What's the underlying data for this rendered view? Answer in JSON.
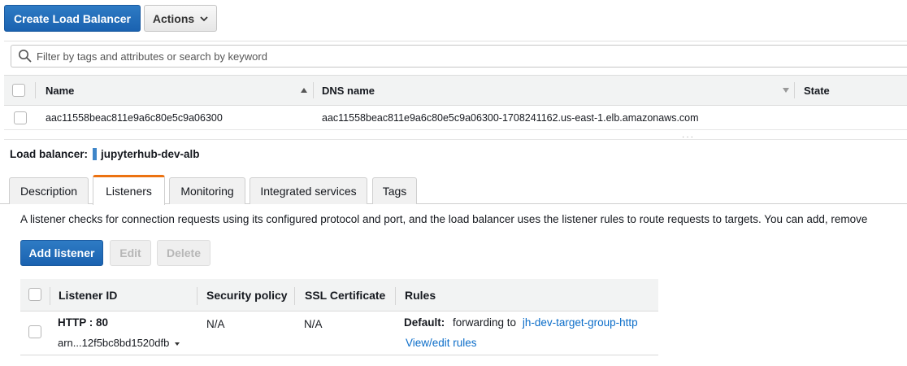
{
  "toolbar": {
    "create_label": "Create Load Balancer",
    "actions_label": "Actions"
  },
  "filter": {
    "placeholder": "Filter by tags and attributes or search by keyword"
  },
  "lb_table": {
    "columns": [
      "Name",
      "DNS name",
      "State"
    ],
    "rows": [
      {
        "name": "aac11558beac811e9a6c80e5c9a06300",
        "dns": "aac11558beac811e9a6c80e5c9a06300-1708241162.us-east-1.elb.amazonaws.com",
        "state": ""
      }
    ]
  },
  "selected_lb": {
    "label": "Load balancer:",
    "name": "jupyterhub-dev-alb"
  },
  "tabs": [
    {
      "label": "Description"
    },
    {
      "label": "Listeners"
    },
    {
      "label": "Monitoring"
    },
    {
      "label": "Integrated services"
    },
    {
      "label": "Tags"
    }
  ],
  "active_tab": "Listeners",
  "listeners": {
    "description": "A listener checks for connection requests using its configured protocol and port, and the load balancer uses the listener rules to route requests to targets. You can add, remove",
    "add_label": "Add listener",
    "edit_label": "Edit",
    "delete_label": "Delete",
    "columns": [
      "Listener ID",
      "Security policy",
      "SSL Certificate",
      "Rules"
    ],
    "rows": [
      {
        "id": "HTTP : 80",
        "arn": "arn...12f5bc8bd1520dfb",
        "security_policy": "N/A",
        "ssl_certificate": "N/A",
        "rules_default_label": "Default:",
        "rules_forwarding": "forwarding to",
        "rules_target": "jh-dev-target-group-http",
        "rules_view_edit": "View/edit rules"
      }
    ]
  },
  "colors": {
    "primary": "#1a62b0",
    "tab_accent": "#ec7211",
    "link": "#0b6dc9"
  }
}
